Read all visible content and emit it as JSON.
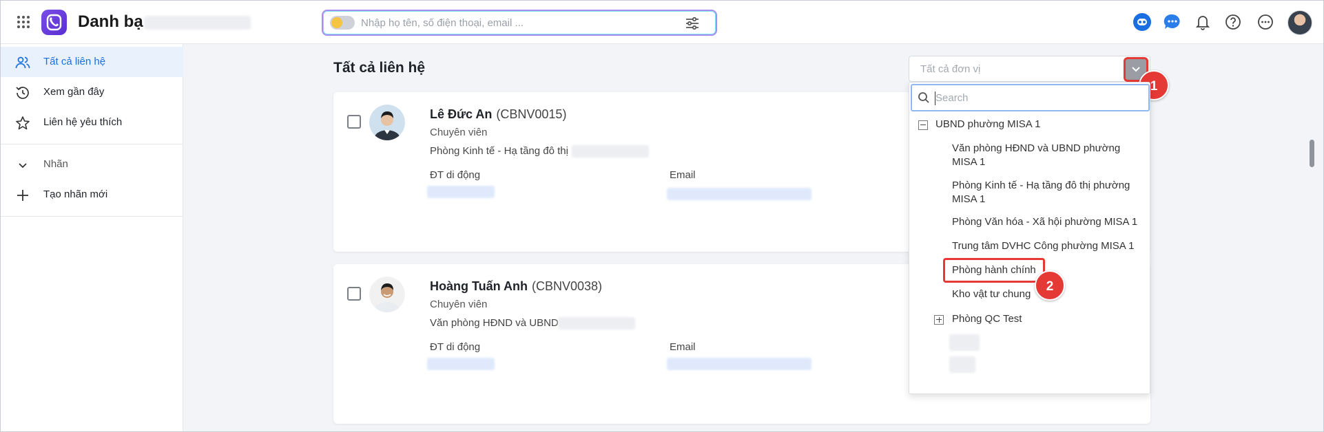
{
  "header": {
    "app_title": "Danh bạ",
    "search_placeholder": "Nhập họ tên, số điện thoại, email ...",
    "icons": [
      "apps-grid-icon",
      "app-logo",
      "filter-sliders-icon",
      "bot-icon",
      "chat-icon",
      "bell-icon",
      "help-icon",
      "more-icon",
      "user-avatar"
    ]
  },
  "sidebar": {
    "items": [
      {
        "label": "Tất cả liên hệ",
        "icon": "contacts-icon",
        "active": true
      },
      {
        "label": "Xem gần đây",
        "icon": "history-icon",
        "active": false
      },
      {
        "label": "Liên hệ yêu thích",
        "icon": "star-icon",
        "active": false
      }
    ],
    "labels_group": {
      "label": "Nhãn",
      "icon": "chevron-down-icon"
    },
    "new_label": {
      "label": "Tạo nhãn mới",
      "icon": "plus-icon"
    }
  },
  "main": {
    "title": "Tất cả liên hệ",
    "unit_select_placeholder": "Tất cả đơn vị",
    "contacts": [
      {
        "name": "Lê Đức An",
        "code": "(CBNV0015)",
        "role": "Chuyên viên",
        "department": "Phòng Kinh tế - Hạ tầng đô thị",
        "phone_label": "ĐT di động",
        "email_label": "Email"
      },
      {
        "name": "Hoàng Tuấn Anh",
        "code": "(CBNV0038)",
        "role": "Chuyên viên",
        "department": "Văn phòng HĐND và UBND",
        "phone_label": "ĐT di động",
        "email_label": "Email"
      }
    ]
  },
  "dropdown": {
    "search_placeholder": "Search",
    "root": "UBND phường MISA 1",
    "children": [
      {
        "line1": "Văn phòng HĐND và UBND phường",
        "line2": "MISA 1"
      },
      {
        "line1": "Phòng Kinh tế - Hạ tầng đô thị phường",
        "line2": "MISA 1"
      },
      {
        "line1": "Phòng Văn hóa - Xã hội phường MISA 1",
        "line2": ""
      },
      {
        "line1": "Trung tâm DVHC Công phường MISA 1",
        "line2": ""
      },
      {
        "line1": "Phòng hành chính",
        "line2": ""
      },
      {
        "line1": "Kho vật tư chung",
        "line2": ""
      },
      {
        "line1": "Phòng QC Test",
        "line2": ""
      }
    ]
  },
  "annotations": {
    "step1": "1",
    "step2": "2"
  },
  "colors": {
    "accent": "#1a6fe0",
    "marker": "#e53935",
    "active_bg": "#e8f1fc",
    "logo": "#6a3ee0"
  }
}
